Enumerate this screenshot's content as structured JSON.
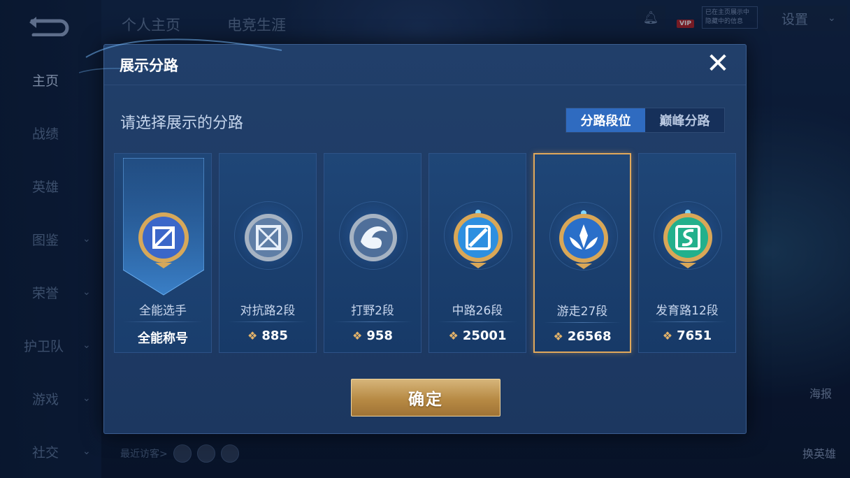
{
  "sidebar": {
    "items": [
      {
        "label": "主页",
        "active": true,
        "chevron": false
      },
      {
        "label": "战绩",
        "active": false,
        "chevron": false
      },
      {
        "label": "英雄",
        "active": false,
        "chevron": false
      },
      {
        "label": "图鉴",
        "active": false,
        "chevron": true
      },
      {
        "label": "荣誉",
        "active": false,
        "chevron": true
      },
      {
        "label": "护卫队",
        "active": false,
        "chevron": true
      },
      {
        "label": "游戏",
        "active": false,
        "chevron": true
      },
      {
        "label": "社交",
        "active": false,
        "chevron": true
      }
    ]
  },
  "top_tabs": [
    "个人主页",
    "电竞生涯"
  ],
  "top_right": {
    "vip_badge": "VIP",
    "status_line1": "已在主页展示中",
    "status_line2": "隐藏中的信息",
    "settings_label": "设置"
  },
  "footer": {
    "recent_visitors_label": "最近访客>",
    "poster_label": "海报",
    "change_hero_label": "换英雄"
  },
  "modal": {
    "title": "展示分路",
    "subtitle": "请选择展示的分路",
    "toggle": {
      "options": [
        "分路段位",
        "巅峰分路"
      ],
      "active_index": 0
    },
    "cards": [
      {
        "name": "全能选手",
        "score": "全能称号",
        "show_diamond": false,
        "badge": "all-round",
        "selected": false
      },
      {
        "name": "对抗路2段",
        "score": "885",
        "show_diamond": true,
        "badge": "clash-lane",
        "selected": false
      },
      {
        "name": "打野2段",
        "score": "958",
        "show_diamond": true,
        "badge": "jungle",
        "selected": false
      },
      {
        "name": "中路26段",
        "score": "25001",
        "show_diamond": true,
        "badge": "mid-lane",
        "selected": false
      },
      {
        "name": "游走27段",
        "score": "26568",
        "show_diamond": true,
        "badge": "roam",
        "selected": true
      },
      {
        "name": "发育路12段",
        "score": "7651",
        "show_diamond": true,
        "badge": "farm-lane",
        "selected": false
      }
    ],
    "confirm_label": "确定",
    "close_icon": "close-icon"
  },
  "colors": {
    "accent_blue": "#2f6bc0",
    "selected_border": "#e0a85b",
    "confirm_gold": "#b78a44"
  }
}
